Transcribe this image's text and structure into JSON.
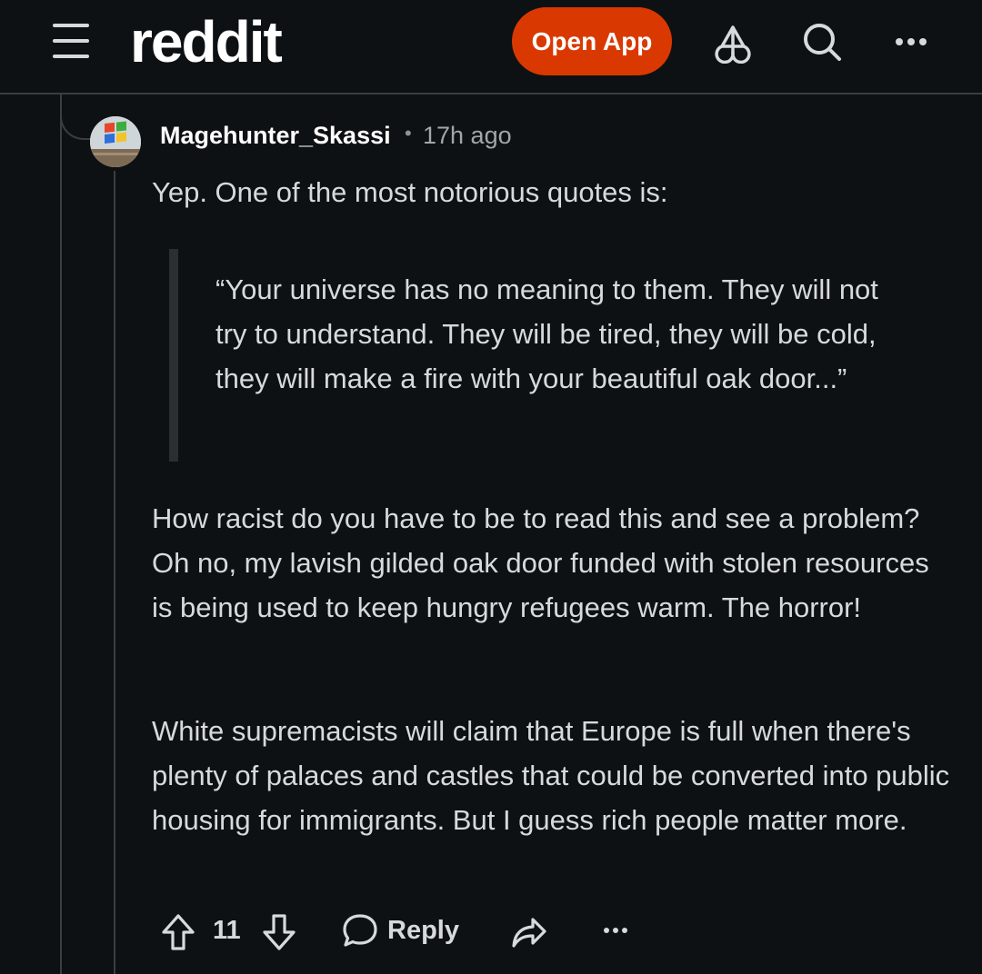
{
  "header": {
    "logo_text": "reddit",
    "open_app_label": "Open App",
    "icons": [
      "menu-icon",
      "avatar-icon",
      "search-icon",
      "more-icon"
    ],
    "accent_color": "#d93900"
  },
  "comment": {
    "author": "Magehunter_Skassi",
    "separator": "•",
    "time": "17h ago",
    "intro": "Yep. One of the most notorious quotes is:",
    "quote": "“Your universe has no meaning to them. They will not try to understand. They will be tired, they will be cold, they will make a fire with your beautiful oak door...”",
    "paragraph_1": "How racist do you have to be to read this and see a problem? Oh no, my lavish gilded oak door funded with stolen resources is being used to keep hungry refugees warm. The horror!",
    "paragraph_2": "White supremacists will claim that Europe is full when there's plenty of palaces and castles that could be converted into public housing for immigrants. But I guess rich people matter more.",
    "actions": {
      "vote_count": "11",
      "reply_label": "Reply",
      "icons": [
        "upvote-icon",
        "downvote-icon",
        "reply-icon",
        "share-icon",
        "more-icon"
      ]
    }
  }
}
